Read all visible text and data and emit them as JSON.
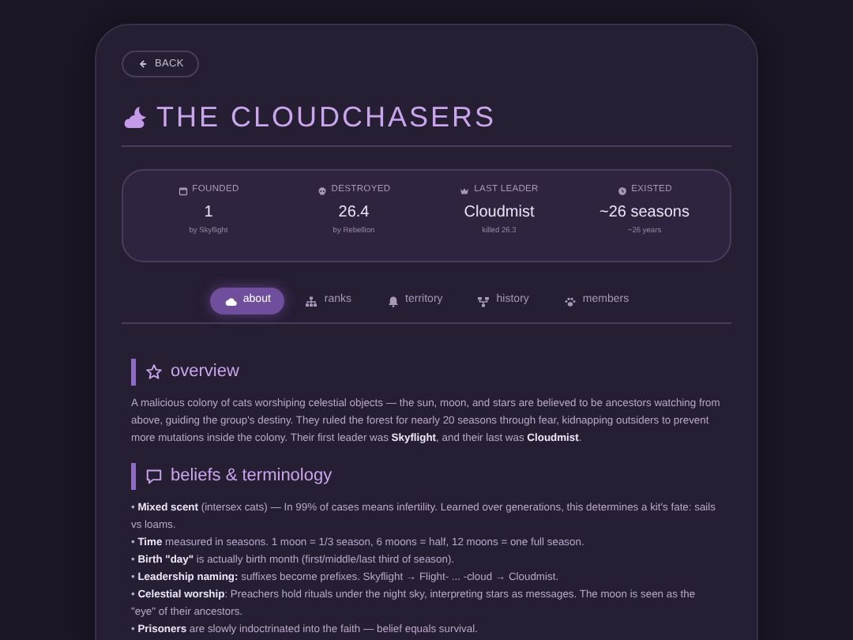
{
  "back_button": {
    "label": "BACK"
  },
  "title": "THE CLOUDCHASERS",
  "stats": [
    {
      "kind": "calendar",
      "label": "FOUNDED",
      "value": "1",
      "note": "by Skyflight"
    },
    {
      "kind": "skull",
      "label": "DESTROYED",
      "value": "26.4",
      "note": "by Rebellion"
    },
    {
      "kind": "crown",
      "label": "LAST LEADER",
      "value": "Cloudmist",
      "note": "killed 26.3"
    },
    {
      "kind": "clock",
      "label": "EXISTED",
      "value": "~26 seasons",
      "note": "~26 years"
    }
  ],
  "tabs": [
    {
      "kind": "cloud",
      "label": "about",
      "selected": true
    },
    {
      "kind": "sitemap",
      "label": "ranks",
      "selected": false
    },
    {
      "kind": "bell",
      "label": "territory",
      "selected": false
    },
    {
      "kind": "history",
      "label": "history",
      "selected": false
    },
    {
      "kind": "paw",
      "label": "members",
      "selected": false
    }
  ],
  "sections": [
    {
      "kind": "star",
      "heading": "overview",
      "paragraphs": [
        "A malicious colony of cats worshiping celestial objects — the sun, moon, and stars are believed to be ancestors watching from above, guiding the group's destiny. They ruled the forest for nearly 20 seasons through fear, kidnapping outsiders to prevent more mutations inside the colony. Their first leader was **Skyflight**, and their last was **Cloudmist**."
      ]
    },
    {
      "kind": "comment",
      "heading": "beliefs & terminology",
      "paragraphs": [
        "• **Mixed scent** (intersex cats) — In 99% of cases means infertility. Learned over generations, this determines a kit's fate: sails vs loams.",
        "• **Time** measured in seasons. 1 moon = 1/3 season, 6 moons = half, 12 moons = one full season.",
        "• **Birth \"day\"** is actually birth month (first/middle/last third of season).",
        "• **Leadership naming:** suffixes become prefixes. Skyflight → Flight- ... -cloud → Cloudmist.",
        "• **Celestial worship**: Preachers hold rituals under the night sky, interpreting stars as messages. The moon is seen as the \"eye\" of their ancestors.",
        "• **Prisoners** are slowly indoctrinated into the faith — belief equals survival."
      ]
    }
  ]
}
